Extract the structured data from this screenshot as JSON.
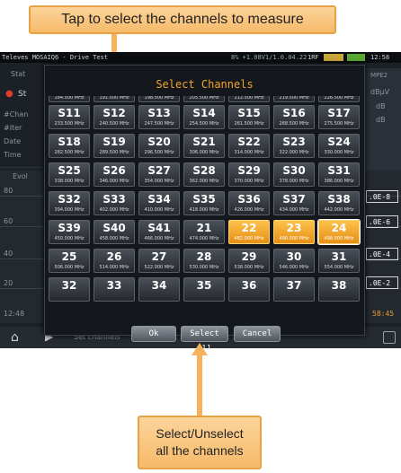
{
  "annotations": {
    "top": "Tap to select the channels to measure",
    "bottom_line1": "Select/Unselect",
    "bottom_line2": "all the channels"
  },
  "topbar": {
    "title": "Televes MOSAIQ6 - Drive Test",
    "status": "8% +1.08V1/1.0.04.22",
    "mode": "1RF",
    "time": "12:58"
  },
  "background": {
    "labels": [
      "Stat",
      "St",
      "#Chan",
      "#Iter",
      "Date",
      "Time",
      "Evol",
      "80",
      "60",
      "40",
      "20",
      "12:48"
    ],
    "right_labels": [
      "MPE2",
      "dBµV",
      "dB",
      "dB"
    ],
    "right_boxes": [
      ".0E-8",
      ".0E-6",
      ".0E-4",
      ".0E-2"
    ],
    "right_time": "58:45",
    "bottom_label": "Set channels"
  },
  "modal": {
    "title": "Select Channels",
    "buttons": {
      "ok": "Ok",
      "select_all": "Select all",
      "cancel": "Cancel"
    },
    "partial_top_row": [
      "184.500 MHz",
      "191.500 MHz",
      "198.500 MHz",
      "205.500 MHz",
      "212.500 MHz",
      "219.500 MHz",
      "226.500 MHz"
    ],
    "channels": [
      {
        "name": "S11",
        "freq": "233.500 MHz",
        "selected": false
      },
      {
        "name": "S12",
        "freq": "240.500 MHz",
        "selected": false
      },
      {
        "name": "S13",
        "freq": "247.500 MHz",
        "selected": false
      },
      {
        "name": "S14",
        "freq": "254.500 MHz",
        "selected": false
      },
      {
        "name": "S15",
        "freq": "261.500 MHz",
        "selected": false
      },
      {
        "name": "S16",
        "freq": "268.500 MHz",
        "selected": false
      },
      {
        "name": "S17",
        "freq": "275.500 MHz",
        "selected": false
      },
      {
        "name": "S18",
        "freq": "282.500 MHz",
        "selected": false
      },
      {
        "name": "S19",
        "freq": "289.500 MHz",
        "selected": false
      },
      {
        "name": "S20",
        "freq": "296.500 MHz",
        "selected": false
      },
      {
        "name": "S21",
        "freq": "306.000 MHz",
        "selected": false
      },
      {
        "name": "S22",
        "freq": "314.000 MHz",
        "selected": false
      },
      {
        "name": "S23",
        "freq": "322.000 MHz",
        "selected": false
      },
      {
        "name": "S24",
        "freq": "330.000 MHz",
        "selected": false
      },
      {
        "name": "S25",
        "freq": "338.000 MHz",
        "selected": false
      },
      {
        "name": "S26",
        "freq": "346.000 MHz",
        "selected": false
      },
      {
        "name": "S27",
        "freq": "354.000 MHz",
        "selected": false
      },
      {
        "name": "S28",
        "freq": "362.000 MHz",
        "selected": false
      },
      {
        "name": "S29",
        "freq": "370.000 MHz",
        "selected": false
      },
      {
        "name": "S30",
        "freq": "378.000 MHz",
        "selected": false
      },
      {
        "name": "S31",
        "freq": "386.000 MHz",
        "selected": false
      },
      {
        "name": "S32",
        "freq": "394.000 MHz",
        "selected": false
      },
      {
        "name": "S33",
        "freq": "402.000 MHz",
        "selected": false
      },
      {
        "name": "S34",
        "freq": "410.000 MHz",
        "selected": false
      },
      {
        "name": "S35",
        "freq": "418.000 MHz",
        "selected": false
      },
      {
        "name": "S36",
        "freq": "426.000 MHz",
        "selected": false
      },
      {
        "name": "S37",
        "freq": "434.000 MHz",
        "selected": false
      },
      {
        "name": "S38",
        "freq": "442.000 MHz",
        "selected": false
      },
      {
        "name": "S39",
        "freq": "450.000 MHz",
        "selected": false
      },
      {
        "name": "S40",
        "freq": "458.000 MHz",
        "selected": false
      },
      {
        "name": "S41",
        "freq": "466.000 MHz",
        "selected": false
      },
      {
        "name": "21",
        "freq": "474.000 MHz",
        "selected": false
      },
      {
        "name": "22",
        "freq": "482.000 MHz",
        "selected": true
      },
      {
        "name": "23",
        "freq": "490.000 MHz",
        "selected": true
      },
      {
        "name": "24",
        "freq": "498.000 MHz",
        "selected": true
      },
      {
        "name": "25",
        "freq": "506.000 MHz",
        "selected": false
      },
      {
        "name": "26",
        "freq": "514.000 MHz",
        "selected": false
      },
      {
        "name": "27",
        "freq": "522.000 MHz",
        "selected": false
      },
      {
        "name": "28",
        "freq": "530.000 MHz",
        "selected": false
      },
      {
        "name": "29",
        "freq": "538.000 MHz",
        "selected": false
      },
      {
        "name": "30",
        "freq": "546.000 MHz",
        "selected": false
      },
      {
        "name": "31",
        "freq": "554.000 MHz",
        "selected": false
      },
      {
        "name": "32",
        "freq": "",
        "selected": false
      },
      {
        "name": "33",
        "freq": "",
        "selected": false
      },
      {
        "name": "34",
        "freq": "",
        "selected": false
      },
      {
        "name": "35",
        "freq": "",
        "selected": false
      },
      {
        "name": "36",
        "freq": "",
        "selected": false
      },
      {
        "name": "37",
        "freq": "",
        "selected": false
      },
      {
        "name": "38",
        "freq": "",
        "selected": false
      }
    ]
  },
  "colors": {
    "accent": "#f2a42e",
    "selected": "#f5a623",
    "callout": "#f6ba6a"
  }
}
